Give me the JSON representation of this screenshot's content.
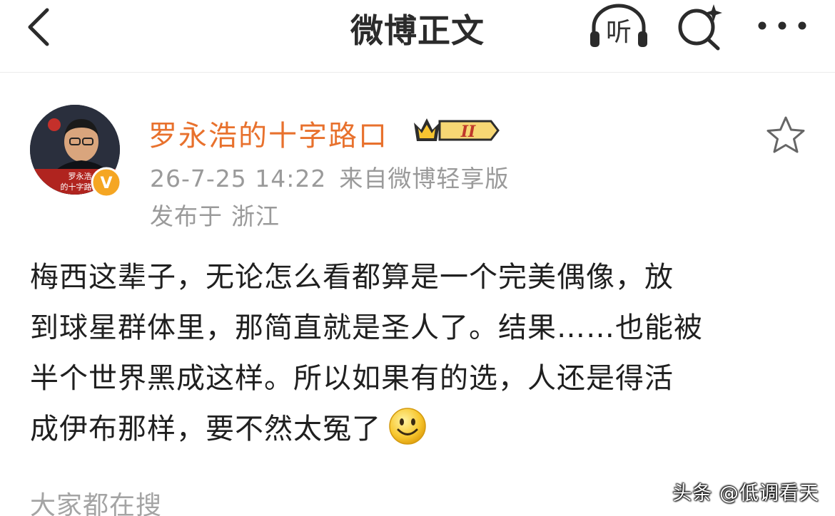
{
  "header": {
    "title": "微博正文",
    "back_icon": "chevron-left-icon",
    "listen_label": "听",
    "search_icon": "search-sparkle-icon",
    "more_icon": "more-dots-icon"
  },
  "post": {
    "author": {
      "name": "罗永浩的十字路口",
      "avatar_icon": "avatar-image",
      "avatar_caption_line1": "罗永浩",
      "avatar_caption_line2": "的十字路口",
      "verified_badge": "V",
      "vip_level": "II",
      "name_color": "#e8712d"
    },
    "timestamp": "26-7-25 14:22",
    "source": "来自微博轻享版",
    "location_label": "发布于",
    "location": "浙江",
    "favorite_icon": "star-outline-icon",
    "content_lines": [
      "梅西这辈子，无论怎么看都算是一个完美偶像，放",
      "到球星群体里，那简直就是圣人了。结果……也能被",
      "半个世界黑成这样。所以如果有的选，人还是得活",
      "成伊布那样，要不然太冤了"
    ],
    "emoji": "smile-emoji"
  },
  "footer": {
    "trending_label": "大家都在搜",
    "watermark": "头条 @低调看天"
  }
}
